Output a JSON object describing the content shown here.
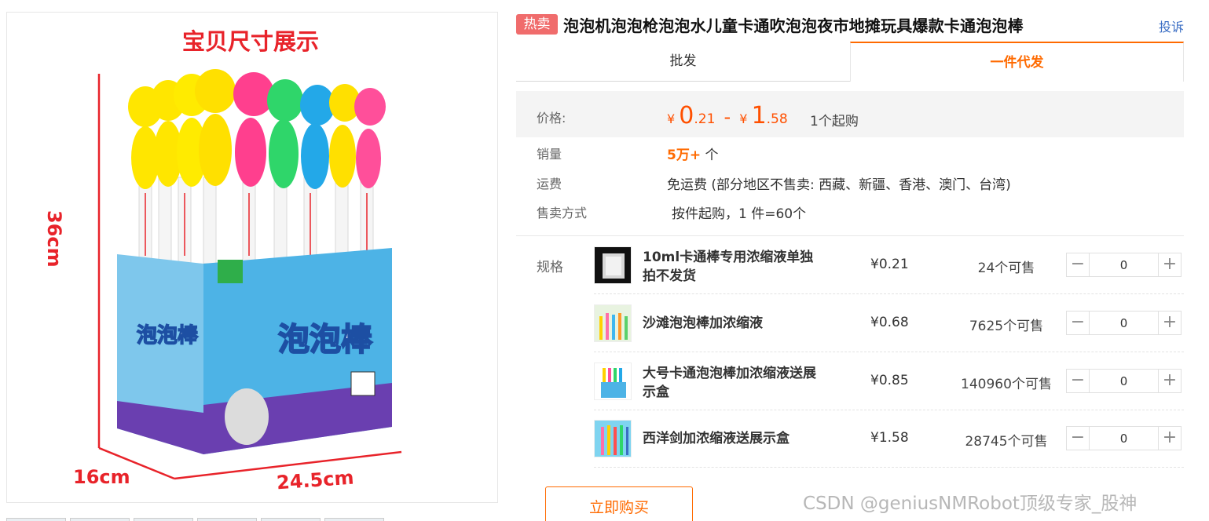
{
  "image": {
    "caption": "宝贝尺寸展示",
    "dim_height": "36cm",
    "dim_depth": "16cm",
    "dim_width": "24.5cm"
  },
  "header": {
    "badge": "热卖",
    "title": "泡泡机泡泡枪泡泡水儿童卡通吹泡泡夜市地摊玩具爆款卡通泡泡棒",
    "report": "投诉"
  },
  "tabs": {
    "wholesale": "批发",
    "dropship": "一件代发"
  },
  "price": {
    "label": "价格:",
    "low_currency": "¥",
    "low_int": "0",
    "low_dec": ".21",
    "sep": "-",
    "high_currency": "¥",
    "high_int": "1",
    "high_dec": ".58",
    "min_order": "1个起购"
  },
  "sales": {
    "label": "销量",
    "value": "5万+",
    "unit": " 个"
  },
  "shipping": {
    "label": "运费",
    "value": "免运费 (部分地区不售卖: 西藏、新疆、香港、澳门、台湾)"
  },
  "sale_method": {
    "label": "售卖方式",
    "value": "按件起购，1 件=60个"
  },
  "spec_label": "规格",
  "skus": [
    {
      "name": "10ml卡通棒专用浓缩液单独拍不发货",
      "price": "¥0.21",
      "stock": "24个可售",
      "qty": "0"
    },
    {
      "name": "沙滩泡泡棒加浓缩液",
      "price": "¥0.68",
      "stock": "7625个可售",
      "qty": "0"
    },
    {
      "name": "大号卡通泡泡棒加浓缩液送展示盒",
      "price": "¥0.85",
      "stock": "140960个可售",
      "qty": "0"
    },
    {
      "name": "西洋剑加浓缩液送展示盒",
      "price": "¥1.58",
      "stock": "28745个可售",
      "qty": "0"
    }
  ],
  "stepper": {
    "minus": "−",
    "plus": "+"
  },
  "buy_button": "立即购买",
  "watermark": "CSDN @geniusNMRobot顶级专家_股神",
  "colors": {
    "accent": "#ff6a00",
    "hot_badge": "#f06c6c",
    "caption_red": "#e8232a",
    "link": "#3b6ec4"
  }
}
